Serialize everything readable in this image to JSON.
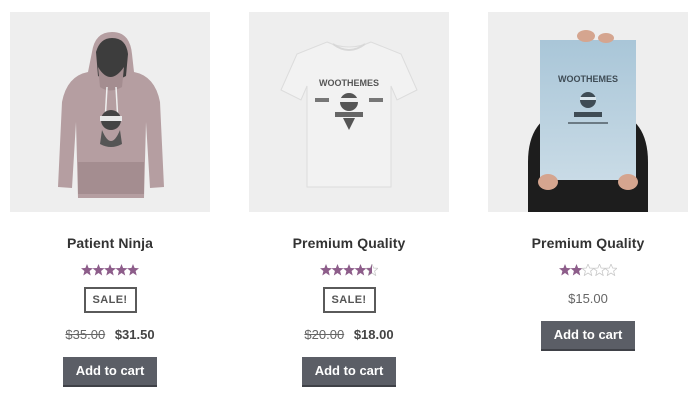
{
  "products": [
    {
      "title": "Patient Ninja",
      "rating": 5,
      "sale_badge": "SALE!",
      "price_old": "$35.00",
      "price_new": "$31.50",
      "button": "Add to cart"
    },
    {
      "title": "Premium Quality",
      "rating": 4.4,
      "sale_badge": "SALE!",
      "price_old": "$20.00",
      "price_new": "$18.00",
      "button": "Add to cart"
    },
    {
      "title": "Premium Quality",
      "rating": 2,
      "price": "$15.00",
      "button": "Add to cart"
    }
  ],
  "images": {
    "tshirt_brand": "WOOTHEMES",
    "poster_brand": "WOOTHEMES"
  },
  "colors": {
    "star": "#8d5d8a",
    "button": "#5b5e66",
    "thumb_bg": "#eeeeee"
  }
}
